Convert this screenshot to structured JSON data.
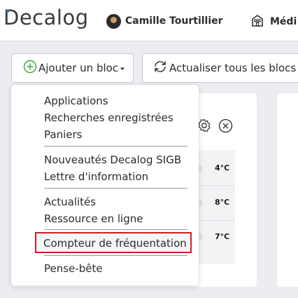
{
  "header": {
    "logo_text": "Decalog",
    "user_name": "Camille Tourtillier",
    "site_name": "Médi"
  },
  "toolbar": {
    "add_block_label": "Ajouter un bloc",
    "refresh_all_label": "Actualiser tous les blocs"
  },
  "menu": {
    "group1": [
      "Applications",
      "Recherches enregistrées",
      "Paniers"
    ],
    "group2": [
      "Nouveautés Decalog SIGB",
      "Lettre d'information"
    ],
    "group3": [
      "Actualités",
      "Ressource en ligne"
    ],
    "group4": [
      "Compteur de fréquentation"
    ],
    "group5": [
      "Pense-bête"
    ]
  },
  "weather": {
    "temps": [
      "4°C",
      "8°C",
      "7°C"
    ]
  },
  "colors": {
    "accent_green": "#3aa63a",
    "highlight_red": "#cc1f24",
    "logo_blue": "#1f7ad6"
  }
}
